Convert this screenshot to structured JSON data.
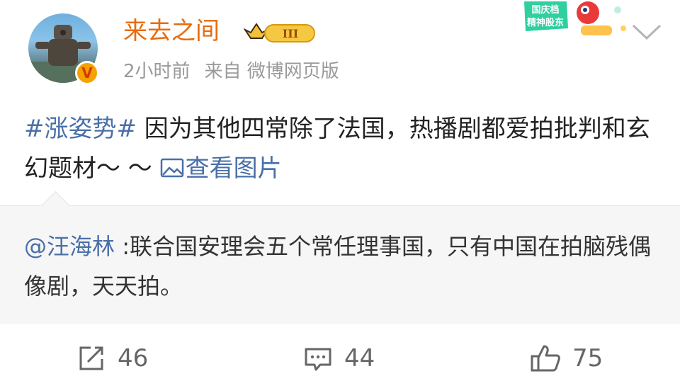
{
  "user": {
    "name": "来去之间",
    "level_badge": "III",
    "verified_badge": "V",
    "time": "2小时前",
    "source": "来自 微博网页版"
  },
  "promo": {
    "text_line1": "国庆档",
    "text_line2": "精神股东"
  },
  "post": {
    "hashtag": "#涨姿势#",
    "text": " 因为其他四常除了法国，热播剧都爱拍批判和玄幻题材～ ～ ",
    "view_image": "查看图片"
  },
  "quote": {
    "mention": "@汪海林",
    "text": " :联合国安理会五个常任理事国，只有中国在拍脑残偶像剧，天天拍。"
  },
  "actions": {
    "repost_count": "46",
    "comment_count": "44",
    "like_count": "75"
  },
  "colors": {
    "username": "#e86b0c",
    "link": "#4a6fa8",
    "meta": "#9a9a9a"
  }
}
